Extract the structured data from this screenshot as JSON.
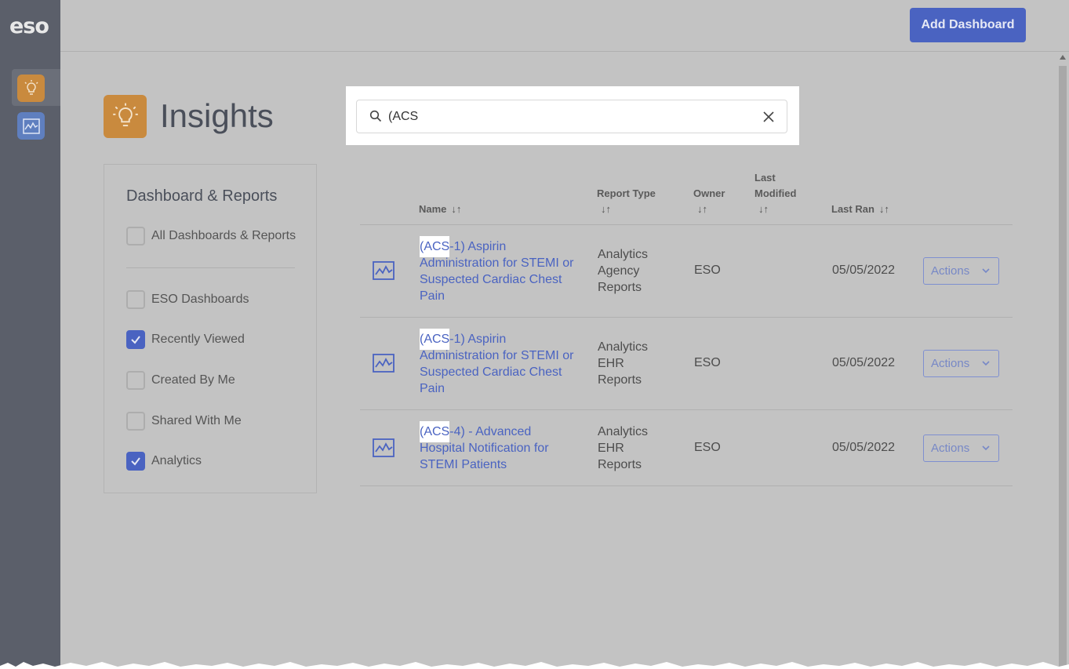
{
  "app": {
    "logo": "eso"
  },
  "topbar": {
    "add_dashboard_label": "Add Dashboard"
  },
  "page": {
    "title": "Insights"
  },
  "search": {
    "value": "(ACS",
    "placeholder": ""
  },
  "filters": {
    "title": "Dashboard & Reports",
    "items": [
      {
        "label": "All Dashboards & Reports",
        "checked": false
      },
      {
        "label": "ESO Dashboards",
        "checked": false
      },
      {
        "label": "Recently Viewed",
        "checked": true
      },
      {
        "label": "Created By Me",
        "checked": false
      },
      {
        "label": "Shared With Me",
        "checked": false
      },
      {
        "label": "Analytics",
        "checked": true
      }
    ]
  },
  "table": {
    "headers": {
      "name": "Name",
      "report_type": "Report Type",
      "owner": "Owner",
      "last_modified_1": "Last",
      "last_modified_2": "Modified",
      "last_ran": "Last Ran",
      "sort_glyph": "↓↑"
    },
    "rows": [
      {
        "name_highlight": "(ACS",
        "name_rest": "-1) Aspirin Administration for STEMI or Suspected Cardiac Chest Pain",
        "type_1": "Analytics",
        "type_2": "Agency",
        "type_3": "Reports",
        "owner": "ESO",
        "last_modified": "",
        "last_ran": "05/05/2022",
        "action_label": "Actions",
        "icon": "analytics-chart-icon"
      },
      {
        "name_highlight": "(ACS",
        "name_rest": "-1) Aspirin Administration for STEMI or Suspected Cardiac Chest Pain",
        "type_1": "Analytics",
        "type_2": "EHR",
        "type_3": "Reports",
        "owner": "ESO",
        "last_modified": "",
        "last_ran": "05/05/2022",
        "action_label": "Actions",
        "icon": "analytics-chart-icon"
      },
      {
        "name_highlight": "(ACS",
        "name_rest": "-4) - Advanced Hospital Notification for STEMI Patients",
        "type_1": "Analytics",
        "type_2": "EHR",
        "type_3": "Reports",
        "owner": "ESO",
        "last_modified": "",
        "last_ran": "05/05/2022",
        "action_label": "Actions",
        "icon": "analytics-chart-icon"
      }
    ]
  },
  "colors": {
    "accent": "#4a63c1",
    "insights_orange": "#c98a3e",
    "rail": "#5b5f6a",
    "overlay_background": "#c3c3c3"
  }
}
